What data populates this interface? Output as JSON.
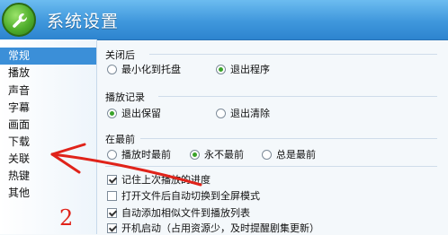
{
  "window": {
    "title": "系统设置"
  },
  "sidebar": {
    "items": [
      {
        "label": "常规",
        "active": true
      },
      {
        "label": "播放",
        "active": false
      },
      {
        "label": "声音",
        "active": false
      },
      {
        "label": "字幕",
        "active": false
      },
      {
        "label": "画面",
        "active": false
      },
      {
        "label": "下载",
        "active": false
      },
      {
        "label": "关联",
        "active": false
      },
      {
        "label": "热键",
        "active": false
      },
      {
        "label": "其他",
        "active": false
      }
    ]
  },
  "sections": {
    "close": {
      "title": "关闭后",
      "options": [
        {
          "label": "最小化到托盘",
          "checked": false
        },
        {
          "label": "退出程序",
          "checked": true
        }
      ]
    },
    "history": {
      "title": "播放记录",
      "options": [
        {
          "label": "退出保留",
          "checked": true
        },
        {
          "label": "退出清除",
          "checked": false
        }
      ]
    },
    "ontop": {
      "title": "在最前",
      "options": [
        {
          "label": "播放时最前",
          "checked": false
        },
        {
          "label": "永不最前",
          "checked": true
        },
        {
          "label": "总是最前",
          "checked": false
        }
      ]
    }
  },
  "checkboxes": [
    {
      "label": "记住上次播放的进度",
      "checked": true
    },
    {
      "label": "打开文件后自动切换到全屏模式",
      "checked": false
    },
    {
      "label": "自动添加相似文件到播放列表",
      "checked": true
    },
    {
      "label": "开机启动（占用资源少，及时提醒剧集更新）",
      "checked": true
    }
  ],
  "annotation": {
    "number": "2"
  },
  "colors": {
    "titlebar": "#3f97dc",
    "selected": "#3b8fd8",
    "annotation": "#e0231a"
  }
}
